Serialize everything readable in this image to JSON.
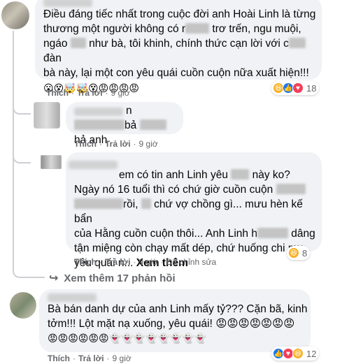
{
  "comments": [
    {
      "text_lines": [
        "Điều đáng tiếc nhất trong cuộc đời anh Hoài Linh là từng",
        [
          "thương một người không có r",
          " trơ trến, ngu muội,"
        ],
        [
          "ngáo ",
          " như bà, tôi khinh, chính thức cạn lời với c",
          " đàn"
        ],
        "bà này, lại một con yêu quái cuồn cuộn nữa xuất hiện!!!"
      ],
      "emojis": "😮😵🤯🤯😵😡😡😡😡",
      "reactions": {
        "icons": [
          "haha",
          "like",
          "love"
        ],
        "count": "18"
      },
      "actions": {
        "like": "Thích",
        "reply": "Trả lời",
        "time": "9 giờ"
      }
    },
    {
      "text_lines": [
        [
          "",
          "n"
        ],
        [
          "",
          "bả ",
          " hả anh"
        ]
      ],
      "actions": {
        "like": "Thích",
        "reply": "Trả lời",
        "time": "9 giờ"
      }
    },
    {
      "text_lines": [
        [
          "",
          "em có tin anh Linh yêu ",
          " này ko?"
        ],
        [
          "Ngày nó 16 tuổi thì có chứ giờ cuồn cuộn ",
          ""
        ],
        [
          "",
          "rồi, ",
          " chứ vợ chồng gì... mưu hèn kế bẩn"
        ],
        [
          "của Hằng cuồn cuộn thôi... Anh Linh h",
          " dâng"
        ],
        "tận miệng còn chạy mất dép, chứ huống chi mụ",
        "yêu quái n..."
      ],
      "see_more": "Xem thêm",
      "reactions": {
        "icons": [
          "haha"
        ],
        "count": "8"
      },
      "actions": {
        "like": "Thích",
        "reply": "Trả lời",
        "time": "9 giờ",
        "edited": "Đã chỉnh sửa"
      }
    },
    {
      "text_lines": [
        "Bà bán danh dự của anh Linh mấy tỷ??? Cặn bã, kinh",
        "tởm!!! Lột mặt nạ xuống, yêu quái! 😡😡😡😡😡😡😡",
        "😡😡😡😡😡😡👻👻👻👻👻👻👻👻"
      ],
      "reactions": {
        "icons": [
          "like",
          "love",
          "haha"
        ],
        "count": "12"
      },
      "actions": {
        "like": "Thích",
        "reply": "Trả lời",
        "time": "9 giờ"
      }
    }
  ],
  "view_more_replies": "Xem thêm 17 phản hồi"
}
